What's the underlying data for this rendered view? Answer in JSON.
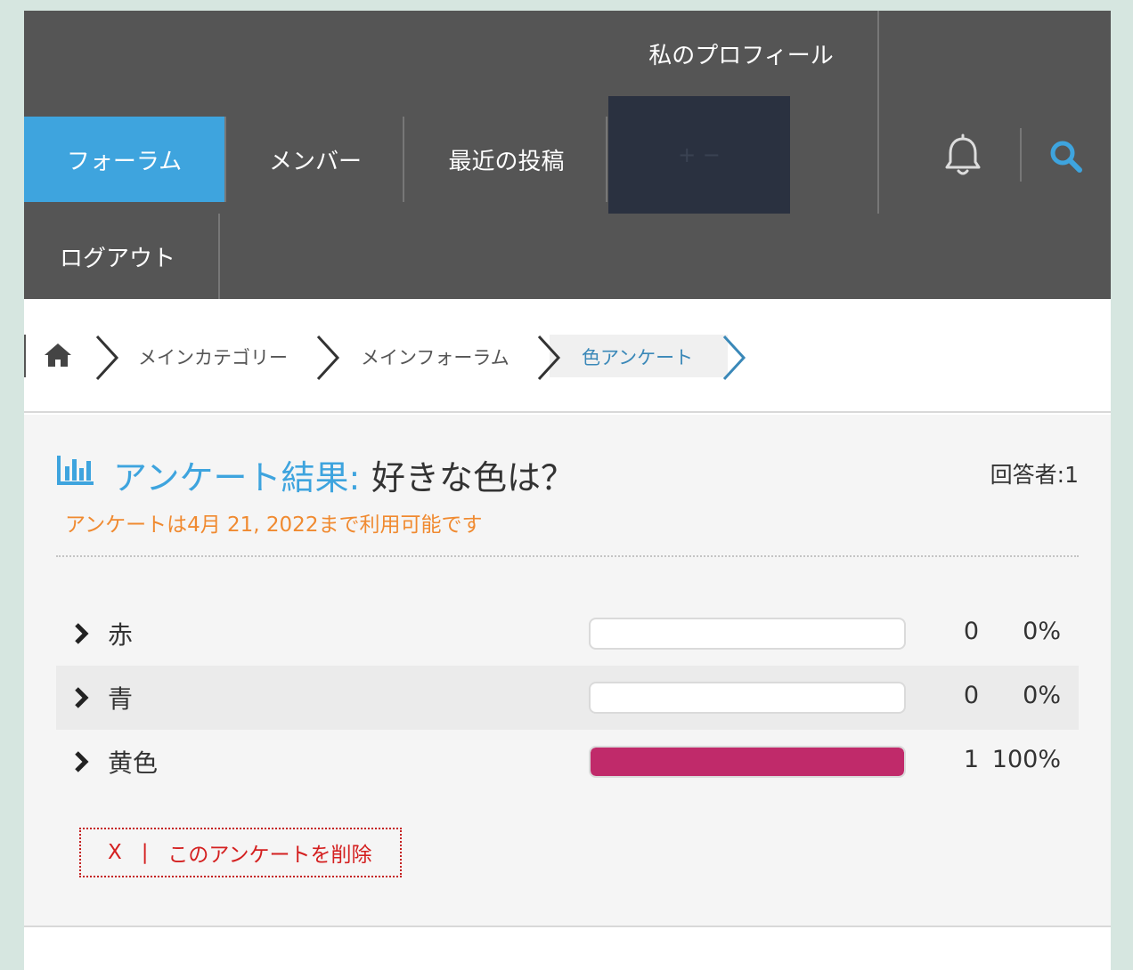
{
  "nav": {
    "profile": "私のプロフィール",
    "forum": "フォーラム",
    "members": "メンバー",
    "recent": "最近の投稿",
    "hidden_item": "+ −",
    "logout": "ログアウト",
    "active_color": "#3ea4de",
    "icons": [
      "bell-icon",
      "search-icon"
    ]
  },
  "breadcrumb": {
    "icons": [
      "home-icon"
    ],
    "items": [
      "メインカテゴリー",
      "メインフォーラム"
    ],
    "current": "色アンケート"
  },
  "poll": {
    "label": "アンケート結果:",
    "question": "好きな色は？",
    "voters_label": "回答者:",
    "voters_count": "1",
    "deadline": "アンケートは4月 21, 2022まで利用可能です",
    "bar_color": "#c02a6a",
    "options": [
      {
        "label": "赤",
        "count": "0",
        "percent": "0%",
        "fraction": 0
      },
      {
        "label": "青",
        "count": "0",
        "percent": "0%",
        "fraction": 0
      },
      {
        "label": "黄色",
        "count": "1",
        "percent": "100%",
        "fraction": 1
      }
    ],
    "delete_x": "X",
    "delete_sep": "|",
    "delete_label": "このアンケートを削除"
  }
}
